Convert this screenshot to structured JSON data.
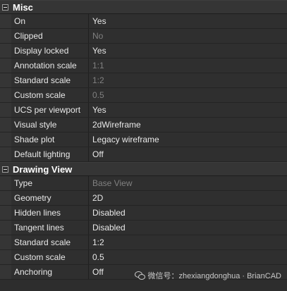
{
  "sections": [
    {
      "title": "Misc",
      "rows": [
        {
          "name": "On",
          "value": "Yes",
          "enabled": true
        },
        {
          "name": "Clipped",
          "value": "No",
          "enabled": false
        },
        {
          "name": "Display locked",
          "value": "Yes",
          "enabled": true
        },
        {
          "name": "Annotation scale",
          "value": "1:1",
          "enabled": false
        },
        {
          "name": "Standard scale",
          "value": "1:2",
          "enabled": false
        },
        {
          "name": "Custom scale",
          "value": "0.5",
          "enabled": false
        },
        {
          "name": "UCS per viewport",
          "value": "Yes",
          "enabled": true
        },
        {
          "name": "Visual style",
          "value": "2dWireframe",
          "enabled": true
        },
        {
          "name": "Shade plot",
          "value": "Legacy wireframe",
          "enabled": true
        },
        {
          "name": "Default lighting",
          "value": "Off",
          "enabled": true
        }
      ]
    },
    {
      "title": "Drawing View",
      "rows": [
        {
          "name": "Type",
          "value": "Base View",
          "enabled": false
        },
        {
          "name": "Geometry",
          "value": "2D",
          "enabled": true
        },
        {
          "name": "Hidden lines",
          "value": "Disabled",
          "enabled": true
        },
        {
          "name": "Tangent lines",
          "value": "Disabled",
          "enabled": true
        },
        {
          "name": "Standard scale",
          "value": "1:2",
          "enabled": true
        },
        {
          "name": "Custom scale",
          "value": "0.5",
          "enabled": true
        },
        {
          "name": "Anchoring",
          "value": "Off",
          "enabled": true
        }
      ]
    }
  ],
  "watermark": {
    "text": "微信号：zhexiangdonghua · BrianCAD"
  },
  "colors": {
    "background": "#2d2d2d",
    "text": "#e8e8e8",
    "disabled_text": "#808080"
  }
}
